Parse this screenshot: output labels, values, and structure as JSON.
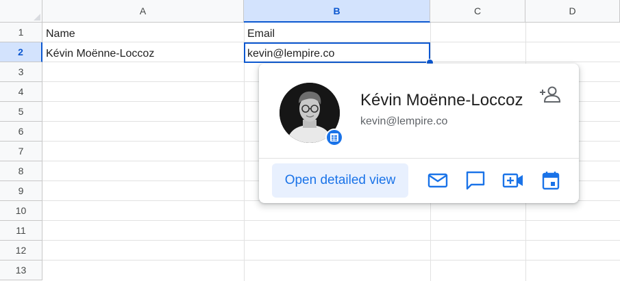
{
  "columns": [
    "A",
    "B",
    "C",
    "D"
  ],
  "rows": [
    "1",
    "2",
    "3",
    "4",
    "5",
    "6",
    "7",
    "8",
    "9",
    "10",
    "11",
    "12",
    "13"
  ],
  "cells": {
    "a1": "Name",
    "b1": "Email",
    "a2": "Kévin Moënne-Loccoz",
    "b2": "kevin@lempire.co"
  },
  "selected_cell": "B2",
  "contact_card": {
    "name": "Kévin Moënne-Loccoz",
    "email": "kevin@lempire.co",
    "open_button": "Open detailed view",
    "icons": [
      "add-person-icon",
      "mail-icon",
      "chat-icon",
      "video-call-icon",
      "calendar-icon"
    ]
  },
  "colors": {
    "accent": "#1a73e8",
    "selection": "#0b57d0",
    "header_selected_bg": "#d3e3fd"
  }
}
